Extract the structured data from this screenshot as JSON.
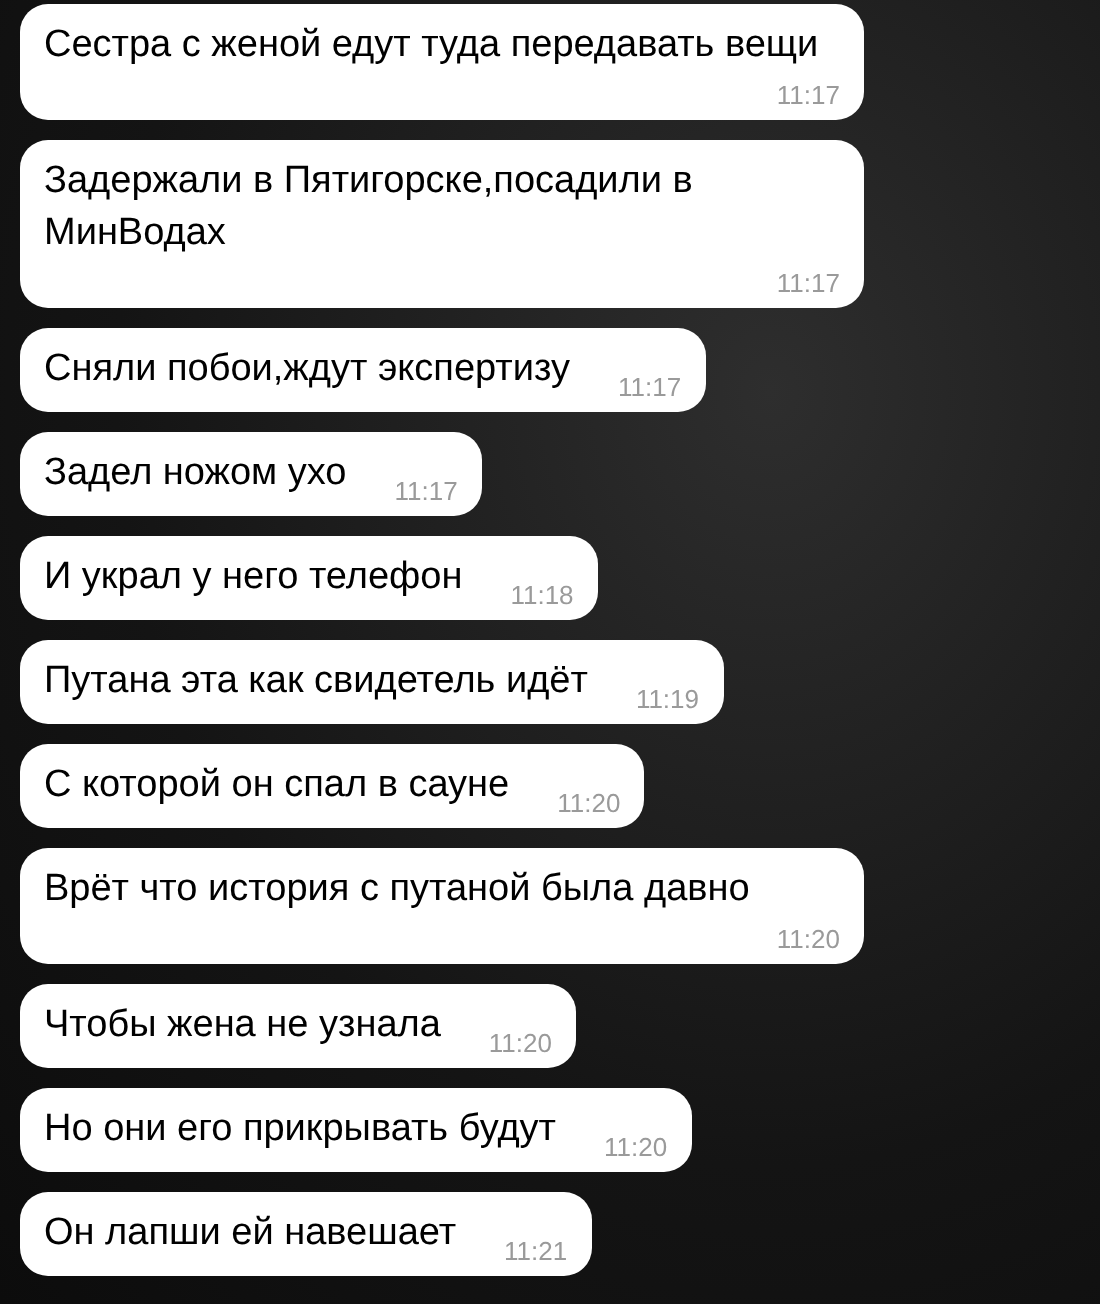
{
  "messages": [
    {
      "text": "Сестра с женой едут туда передавать вещи",
      "time": "11:17"
    },
    {
      "text": "Задержали в Пятигорске,посадили в МинВодах",
      "time": "11:17"
    },
    {
      "text": "Сняли побои,ждут экспертизу",
      "time": "11:17"
    },
    {
      "text": "Задел ножом ухо",
      "time": "11:17"
    },
    {
      "text": "И украл у него телефон",
      "time": "11:18"
    },
    {
      "text": "Путана эта как свидетель идёт",
      "time": "11:19"
    },
    {
      "text": "С которой он спал в сауне",
      "time": "11:20"
    },
    {
      "text": "Врёт что история с путаной была давно",
      "time": "11:20"
    },
    {
      "text": "Чтобы жена не узнала",
      "time": "11:20"
    },
    {
      "text": "Но они его прикрывать будут",
      "time": "11:20"
    },
    {
      "text": "Он лапши ей навешает",
      "time": "11:21"
    }
  ]
}
